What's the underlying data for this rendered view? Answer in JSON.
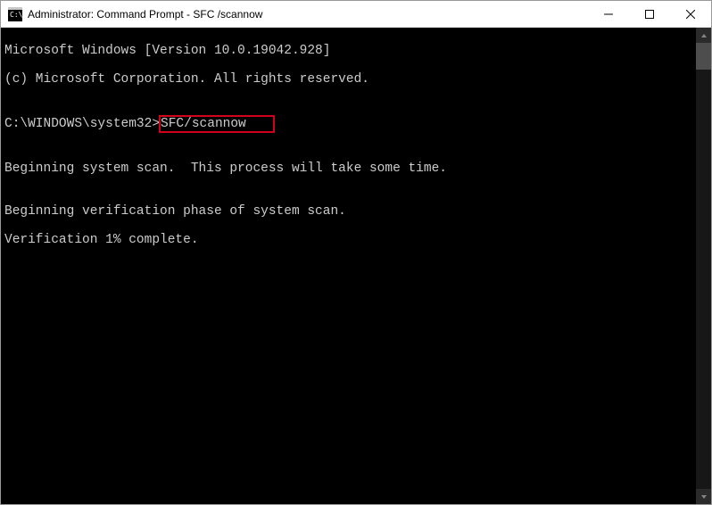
{
  "window": {
    "title": "Administrator: Command Prompt - SFC /scannow"
  },
  "terminal": {
    "line1": "Microsoft Windows [Version 10.0.19042.928]",
    "line2": "(c) Microsoft Corporation. All rights reserved.",
    "line3": "",
    "prompt_line": {
      "prompt": "C:\\WINDOWS\\system32>",
      "command": "SFC/scannow"
    },
    "line5": "",
    "line6": "Beginning system scan.  This process will take some time.",
    "line7": "",
    "line8": "Beginning verification phase of system scan.",
    "line9": "Verification 1% complete."
  }
}
